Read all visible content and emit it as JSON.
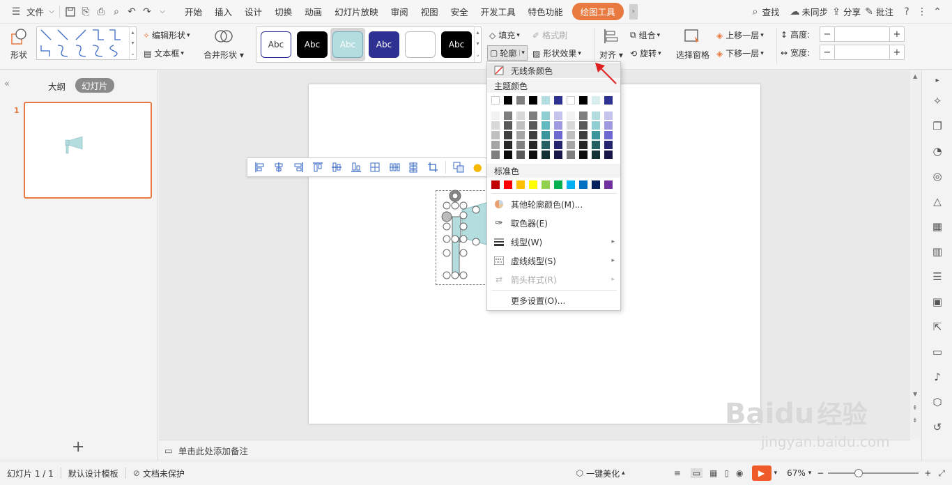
{
  "menubar": {
    "file_label": "文件",
    "tabs": [
      "开始",
      "插入",
      "设计",
      "切换",
      "动画",
      "幻灯片放映",
      "审阅",
      "视图",
      "安全",
      "开发工具",
      "特色功能"
    ],
    "active_tab": "绘图工具",
    "search_label": "查找",
    "sync_label": "未同步",
    "share_label": "分享",
    "comment_label": "批注"
  },
  "ribbon": {
    "shape_label": "形状",
    "edit_shape_label": "编辑形状",
    "textbox_label": "文本框",
    "merge_shape_label": "合并形状",
    "style_samples": [
      "Abc",
      "Abc",
      "Abc",
      "Abc",
      "",
      "Abc"
    ],
    "fill_label": "填充",
    "format_brush_label": "格式刷",
    "outline_label": "轮廓",
    "shape_effect_label": "形状效果",
    "align_label": "对齐",
    "group_label": "组合",
    "rotate_label": "旋转",
    "selection_pane_label": "选择窗格",
    "bring_forward_label": "上移一层",
    "send_backward_label": "下移一层",
    "height_label": "高度:",
    "width_label": "宽度:"
  },
  "leftpanel": {
    "outline_tab": "大纲",
    "slides_tab": "幻灯片",
    "slide_number": "1",
    "add_label": "+"
  },
  "notes": {
    "placeholder": "单击此处添加备注"
  },
  "dropdown": {
    "no_line_color": "无线条颜色",
    "theme_colors_label": "主题颜色",
    "standard_colors_label": "标准色",
    "other_colors": "其他轮廓颜色(M)...",
    "eyedropper": "取色器(E)",
    "line_type": "线型(W)",
    "dash_type": "虚线线型(S)",
    "arrow_style": "箭头样式(R)",
    "more_settings": "更多设置(O)...",
    "theme_top_row": [
      "#ffffff",
      "#000000",
      "#7f7f7f",
      "#000000",
      "#b4dde0",
      "#2e3192",
      "#ffffff",
      "#000000",
      "#d9eeee",
      "#2e3192"
    ],
    "theme_shades": [
      [
        "#f2f2f2",
        "#7f7f7f",
        "#d8d8d8",
        "#7f7f7f",
        "#8fcfd4",
        "#c5c4ef",
        "#f2f2f2",
        "#7f7f7f",
        "#b4dde0",
        "#c5c4ef"
      ],
      [
        "#d8d8d8",
        "#595959",
        "#bfbfbf",
        "#595959",
        "#62b9c0",
        "#9e9ae0",
        "#d8d8d8",
        "#595959",
        "#8fcfd4",
        "#9e9ae0"
      ],
      [
        "#bfbfbf",
        "#3f3f3f",
        "#a5a5a5",
        "#3f3f3f",
        "#3a959c",
        "#6e69d0",
        "#bfbfbf",
        "#3f3f3f",
        "#3a959c",
        "#6e69d0"
      ],
      [
        "#a5a5a5",
        "#262626",
        "#7f7f7f",
        "#262626",
        "#265f63",
        "#23236e",
        "#a5a5a5",
        "#262626",
        "#265f63",
        "#23236e"
      ],
      [
        "#7f7f7f",
        "#0d0d0d",
        "#595959",
        "#0d0d0d",
        "#133033",
        "#171749",
        "#7f7f7f",
        "#0d0d0d",
        "#133033",
        "#171749"
      ]
    ],
    "standard": [
      "#c00000",
      "#ff0000",
      "#ffc000",
      "#ffff00",
      "#92d050",
      "#00b050",
      "#00b0f0",
      "#0070c0",
      "#002060",
      "#7030a0"
    ]
  },
  "status": {
    "slide_count": "幻灯片 1 / 1",
    "template": "默认设计模板",
    "doc_protect": "文档未保护",
    "beautify": "一键美化",
    "zoom": "67%"
  },
  "watermark": {
    "brand": "Baidu",
    "brand_cn": "经验",
    "url": "jingyan.baidu.com"
  },
  "colors": {
    "accent": "#e8793f",
    "selection_teal": "#b4dde0"
  }
}
